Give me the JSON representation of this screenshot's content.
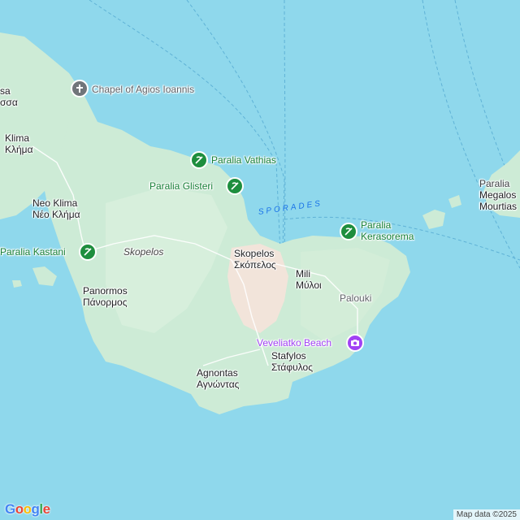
{
  "map": {
    "colors": {
      "sea": "#8fd8ec",
      "land": "#cdebd6",
      "land_light": "#e4f3e5",
      "urban": "#f2e4da",
      "ferry": "#5fb2d6",
      "poi_green": "#188038",
      "poi_purple": "#a142f4"
    },
    "places": {
      "klima": {
        "en": "Klima",
        "gr": "Κλήμα"
      },
      "neo_klima": {
        "en": "Neo Klima",
        "gr": "Νέο Κλήμα"
      },
      "panormos": {
        "en": "Panormos",
        "gr": "Πάνορμος"
      },
      "skopelos_town": {
        "en": "Skopelos",
        "gr": "Σκόπελος"
      },
      "mili": {
        "en": "Mili",
        "gr": "Μύλοι"
      },
      "stafylos": {
        "en": "Stafylos",
        "gr": "Στάφυλος"
      },
      "agnontas": {
        "en": "Agnontas",
        "gr": "Αγνώντας"
      },
      "edge_left": {
        "en": "sa",
        "gr": "σσα"
      },
      "megalos_mourtias": {
        "en": "Megalos",
        "gr": "Mourtias",
        "top": "Paralia"
      }
    },
    "island_label": "Skopelos",
    "area_label": "Palouki",
    "sea_label": "SPORADES",
    "pois": {
      "chapel": {
        "label": "Chapel of Agios Ioannis",
        "icon": "cross-icon"
      },
      "vathias": {
        "label": "Paralia Vathias",
        "icon": "beach-icon"
      },
      "glisteri": {
        "label": "Paralia Glisteri",
        "icon": "beach-icon"
      },
      "kastani": {
        "label": "Paralia Kastani",
        "icon": "beach-icon"
      },
      "kerasorema": {
        "line1": "Paralia",
        "line2": "Kerasorema",
        "icon": "beach-icon"
      },
      "veveliatko": {
        "label": "Veveliatko Beach",
        "icon": "camera-icon"
      }
    },
    "logo": {
      "g1": "G",
      "g2": "o",
      "g3": "o",
      "g4": "g",
      "g5": "l",
      "g6": "e"
    },
    "attribution": "Map data ©2025"
  }
}
